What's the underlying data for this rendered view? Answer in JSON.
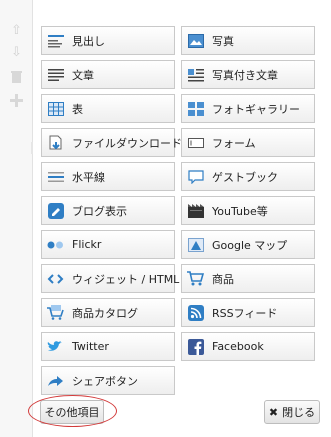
{
  "rail": [
    "up-arrow-icon",
    "down-arrow-icon",
    "trash-icon",
    "add-icon"
  ],
  "items": [
    {
      "label": "見出し",
      "icon": "heading-icon",
      "col": "l",
      "row": 0
    },
    {
      "label": "写真",
      "icon": "photo-icon",
      "col": "r",
      "row": 0
    },
    {
      "label": "文章",
      "icon": "text-icon",
      "col": "l",
      "row": 1
    },
    {
      "label": "写真付き文章",
      "icon": "photo-text-icon",
      "col": "r",
      "row": 1
    },
    {
      "label": "表",
      "icon": "table-icon",
      "col": "l",
      "row": 2
    },
    {
      "label": "フォトギャラリー",
      "icon": "gallery-icon",
      "col": "r",
      "row": 2
    },
    {
      "label": "ファイルダウンロード",
      "icon": "file-download-icon",
      "col": "l",
      "row": 3
    },
    {
      "label": "フォーム",
      "icon": "form-icon",
      "col": "r",
      "row": 3
    },
    {
      "label": "水平線",
      "icon": "horizontal-line-icon",
      "col": "l",
      "row": 4
    },
    {
      "label": "ゲストブック",
      "icon": "guestbook-icon",
      "col": "r",
      "row": 4
    },
    {
      "label": "ブログ表示",
      "icon": "blog-icon",
      "col": "l",
      "row": 5
    },
    {
      "label": "YouTube等",
      "icon": "youtube-icon",
      "col": "r",
      "row": 5
    },
    {
      "label": "Flickr",
      "icon": "flickr-icon",
      "col": "l",
      "row": 6
    },
    {
      "label": "Google マップ",
      "icon": "google-map-icon",
      "col": "r",
      "row": 6
    },
    {
      "label": "ウィジェット / HTML",
      "icon": "widget-html-icon",
      "col": "l",
      "row": 7
    },
    {
      "label": "商品",
      "icon": "product-cart-icon",
      "col": "r",
      "row": 7
    },
    {
      "label": "商品カタログ",
      "icon": "catalog-cart-icon",
      "col": "l",
      "row": 8
    },
    {
      "label": "RSSフィード",
      "icon": "rss-icon",
      "col": "r",
      "row": 8
    },
    {
      "label": "Twitter",
      "icon": "twitter-icon",
      "col": "l",
      "row": 9
    },
    {
      "label": "Facebook",
      "icon": "facebook-icon",
      "col": "r",
      "row": 9
    },
    {
      "label": "シェアボタン",
      "icon": "share-button-icon",
      "col": "l",
      "row": 10
    }
  ],
  "footer": {
    "more_label": "その他項目",
    "close_label": "閉じる"
  },
  "colors": {
    "highlight": "#d23b3b",
    "icon_blue": "#2f7ec4",
    "facebook": "#3b5998"
  }
}
